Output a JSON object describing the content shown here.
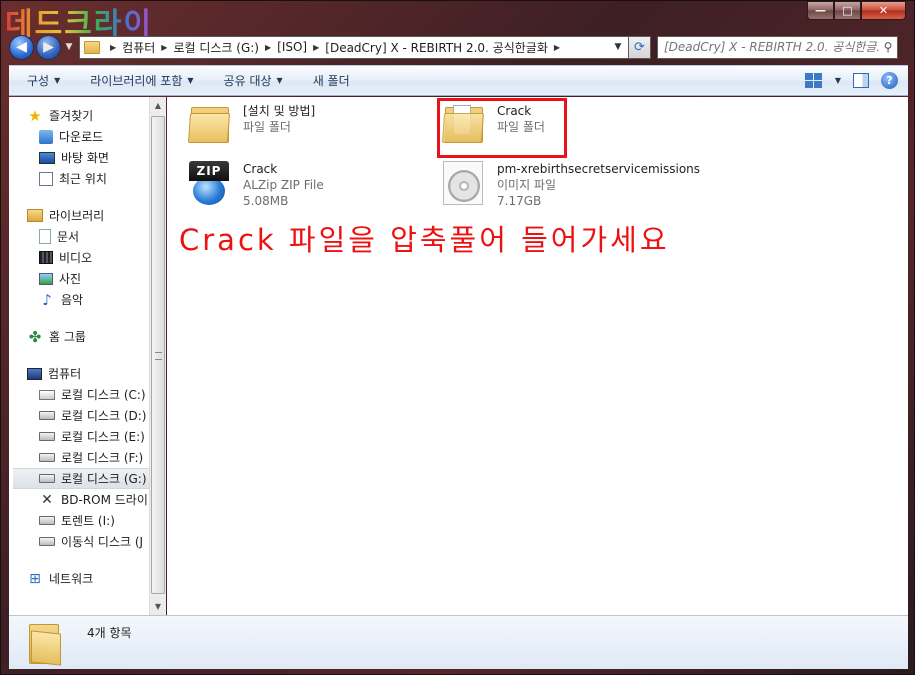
{
  "watermark": {
    "text": "데드크라이"
  },
  "window_controls": {
    "minimize": "—",
    "maximize": "□",
    "close": "✕"
  },
  "address_bar": {
    "crumbs": [
      "컴퓨터",
      "로컬 디스크 (G:)",
      "[ISO]",
      "[DeadCry] X - REBIRTH 2.0. 공식한글화"
    ]
  },
  "search": {
    "placeholder": "[DeadCry] X - REBIRTH 2.0. 공식한글..."
  },
  "toolbar": {
    "organize": "구성",
    "include_library": "라이브러리에 포함",
    "share": "공유 대상",
    "new_folder": "새 폴더",
    "help": "?"
  },
  "sidebar": {
    "favorites": {
      "label": "즐겨찾기",
      "items": [
        "다운로드",
        "바탕 화면",
        "최근 위치"
      ]
    },
    "libraries": {
      "label": "라이브러리",
      "items": [
        "문서",
        "비디오",
        "사진",
        "음악"
      ]
    },
    "homegroup": {
      "label": "홈 그룹"
    },
    "computer": {
      "label": "컴퓨터",
      "items": [
        "로컬 디스크 (C:)",
        "로컬 디스크 (D:)",
        "로컬 디스크 (E:)",
        "로컬 디스크 (F:)",
        "로컬 디스크 (G:)",
        "BD-ROM 드라이",
        "토렌트 (I:)",
        "이동식 디스크 (J"
      ]
    },
    "network": {
      "label": "네트워크"
    }
  },
  "files": [
    {
      "name": "[설치 및 방법]",
      "type": "파일 폴더",
      "size": "",
      "icon": "folder-icon"
    },
    {
      "name": "Crack",
      "type": "파일 폴더",
      "size": "",
      "icon": "folder-icon"
    },
    {
      "name": "Crack",
      "type": "ALZip ZIP File",
      "size": "5.08MB",
      "icon": "zip-icon"
    },
    {
      "name": "pm-xrebirthsecretservicemissions",
      "type": "이미지 파일",
      "size": "7.17GB",
      "icon": "disc-image-icon"
    }
  ],
  "annotation": {
    "text": "Crack 파일을 압축풀어 들어가세요"
  },
  "status": {
    "item_count": "4개 항목"
  },
  "colors": {
    "annotation": "#ee1111",
    "highlight": "#e8121a"
  }
}
